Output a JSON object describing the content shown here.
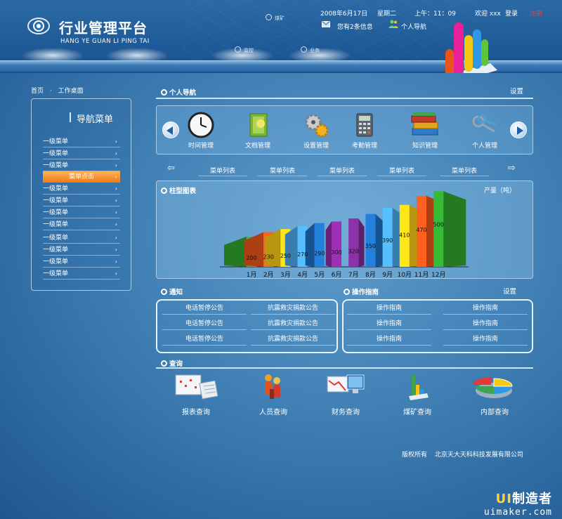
{
  "header": {
    "title": "行业管理平台",
    "subtitle": "HANG YE GUAN LI PING TAI",
    "date": "2008年6月17日",
    "weekday": "星期二",
    "time": "上午：11：09",
    "welcome": "欢迎 xxx",
    "login": "登录",
    "logout": "注销",
    "messages": "您有2条信息",
    "personal_nav": "个人导航",
    "map_labels": [
      "煤矿",
      "监控",
      "业务"
    ]
  },
  "breadcrumb": {
    "home": "首页",
    "sep": "·",
    "current": "工作桌面"
  },
  "sidebar": {
    "title": "导航菜单",
    "items": [
      "一级菜单",
      "一级菜单",
      "一级菜单",
      "菜单点击",
      "一级菜单",
      "一级菜单",
      "一级菜单",
      "一级菜单",
      "一级菜单",
      "一级菜单",
      "一级菜单",
      "一级菜单"
    ]
  },
  "personal_nav": {
    "title": "个人导航",
    "settings": "设置",
    "items": [
      {
        "label": "时间管理",
        "icon": "clock-icon"
      },
      {
        "label": "文档管理",
        "icon": "document-icon"
      },
      {
        "label": "设置管理",
        "icon": "gears-icon"
      },
      {
        "label": "考勤管理",
        "icon": "calculator-icon"
      },
      {
        "label": "知识管理",
        "icon": "books-icon"
      },
      {
        "label": "个人管理",
        "icon": "keys-icon"
      }
    ]
  },
  "subnav": [
    "菜单列表",
    "菜单列表",
    "菜单列表",
    "菜单列表",
    "菜单列表"
  ],
  "chart_section": {
    "title": "柱型图表"
  },
  "chart_data": {
    "type": "bar",
    "title": "柱型图表",
    "ylabel": "产量（吨）",
    "categories": [
      "1月",
      "2月",
      "3月",
      "4月",
      "5月",
      "6月",
      "7月",
      "8月",
      "9月",
      "10月",
      "11月",
      "12月"
    ],
    "values": [
      200,
      230,
      250,
      270,
      290,
      300,
      320,
      350,
      390,
      410,
      470,
      500
    ],
    "colors": [
      "#2fa32f",
      "#e8541a",
      "#f5c814",
      "#4aa6e6",
      "#1f6fc0",
      "#8a2a9e",
      "#7b2a94",
      "#1f6fc0",
      "#4aa6e6",
      "#f5c814",
      "#e8541a",
      "#2fa32f"
    ],
    "ylim": [
      0,
      520
    ],
    "grid": false,
    "legend": "none"
  },
  "notice": {
    "title": "通知",
    "rows": [
      [
        "电话暂停公告",
        "抗震救灾捐款公告"
      ],
      [
        "电话暂停公告",
        "抗震救灾捐款公告"
      ],
      [
        "电话暂停公告",
        "抗震救灾捐款公告"
      ]
    ]
  },
  "guide": {
    "title": "操作指南",
    "settings": "设置",
    "rows": [
      [
        "操作指南",
        "操作指南"
      ],
      [
        "操作指南",
        "操作指南"
      ],
      [
        "操作指南",
        "操作指南"
      ]
    ]
  },
  "query": {
    "title": "查询",
    "items": [
      {
        "label": "报表查询",
        "icon": "report-icon"
      },
      {
        "label": "人员查询",
        "icon": "people-icon"
      },
      {
        "label": "财务查询",
        "icon": "finance-icon"
      },
      {
        "label": "煤矿查询",
        "icon": "mine-icon"
      },
      {
        "label": "内部查询",
        "icon": "pie-chart-icon"
      }
    ]
  },
  "footer": {
    "copyright": "版权所有",
    "company": "北京天大天科科技发展有限公司"
  },
  "watermark": {
    "brand_a": "UI",
    "brand_b": "制造者",
    "url": "uimaker.com"
  }
}
